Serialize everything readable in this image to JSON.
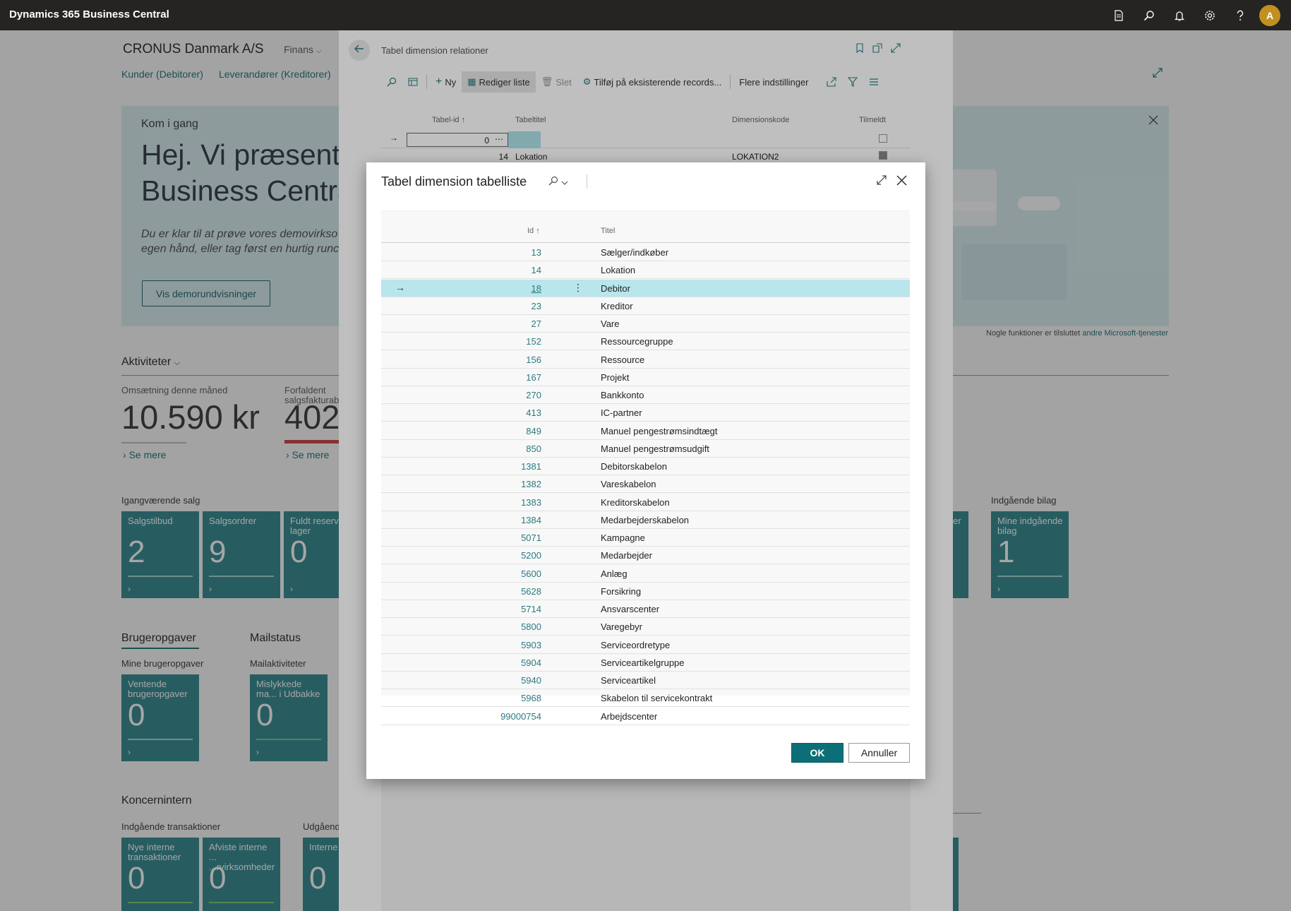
{
  "app": {
    "title": "Dynamics 365 Business Central",
    "avatar_initial": "A"
  },
  "topbar_icons": [
    "document-icon",
    "search-icon",
    "bell-icon",
    "gear-icon",
    "help-icon"
  ],
  "background": {
    "company": "CRONUS Danmark A/S",
    "role_menu": "Finans",
    "links": [
      "Kunder (Debitorer)",
      "Leverandører (Kreditorer)"
    ],
    "hero": {
      "kicker": "Kom i gang",
      "title_line1": "Hej. Vi præsent",
      "title_line2": "Business Centra",
      "sub_line1": "Du er klar til at prøve vores demovirkso",
      "sub_line2": "egen hånd, eller tag først en hurtig runc",
      "button": "Vis demorundvisninger",
      "note": "Nogle funktioner er tilsluttet",
      "note_link": "andre Microsoft-tjenester"
    },
    "activities": {
      "heading": "Aktiviteter",
      "kpi1_label": "Omsætning denne måned",
      "kpi1_value": "10.590 kr",
      "kpi2_label_line1": "Forfaldent",
      "kpi2_label_line2": "salgsfakturab",
      "kpi2_value": "402.",
      "see_more": "Se mere"
    },
    "ongoing_sales": {
      "label": "Igangværende salg",
      "tiles": [
        {
          "label": "Salgstilbud",
          "value": "2"
        },
        {
          "label": "Salgsordrer",
          "value": "9"
        },
        {
          "label": "Fuldt reserv fra lager",
          "value": "0"
        }
      ]
    },
    "incoming_docs": {
      "label": "Indgående bilag",
      "tile_label": "Mine indgående bilag",
      "tile_value": "1",
      "partial_tile_label": "er"
    },
    "user_tasks": {
      "heading": "Brugeropgaver",
      "label": "Mine brugeropgaver",
      "tile_label": "Ventende brugeropgaver",
      "tile_value": "0"
    },
    "mail": {
      "heading": "Mailstatus",
      "label": "Mailaktiviteter",
      "tile_label": "Mislykkede ma... i Udbakke",
      "tile_value": "0"
    },
    "intercompany": {
      "heading": "Koncernintern",
      "label_in": "Indgående transaktioner",
      "label_out": "Udgåend",
      "tiles": [
        {
          "label": "Nye interne transaktioner",
          "value": "0"
        },
        {
          "label": "Afviste interne ... ...rvirksomheder",
          "value": "0"
        },
        {
          "label": "Interne til afsen",
          "value": "0"
        }
      ]
    }
  },
  "panel": {
    "title": "Tabel dimension relationer",
    "commands": {
      "new": "Ny",
      "edit_list": "Rediger liste",
      "delete": "Slet",
      "add_existing": "Tilføj på eksisterende records...",
      "more": "Flere indstillinger"
    },
    "columns": {
      "table_id": "Tabel-id",
      "table_title": "Tabeltitel",
      "dim_code": "Dimensionskode",
      "enrolled": "Tilmeldt"
    },
    "rows": [
      {
        "id": "0",
        "title": "",
        "code": ""
      },
      {
        "id": "14",
        "title": "Lokation",
        "code": "LOKATION2"
      }
    ]
  },
  "modal": {
    "title": "Tabel dimension tabelliste",
    "col_id": "Id",
    "col_title": "Titel",
    "rows": [
      {
        "id": "13",
        "title": "Sælger/indkøber"
      },
      {
        "id": "14",
        "title": "Lokation"
      },
      {
        "id": "18",
        "title": "Debitor"
      },
      {
        "id": "23",
        "title": "Kreditor"
      },
      {
        "id": "27",
        "title": "Vare"
      },
      {
        "id": "152",
        "title": "Ressourcegruppe"
      },
      {
        "id": "156",
        "title": "Ressource"
      },
      {
        "id": "167",
        "title": "Projekt"
      },
      {
        "id": "270",
        "title": "Bankkonto"
      },
      {
        "id": "413",
        "title": "IC-partner"
      },
      {
        "id": "849",
        "title": "Manuel pengestrømsindtægt"
      },
      {
        "id": "850",
        "title": "Manuel pengestrømsudgift"
      },
      {
        "id": "1381",
        "title": "Debitorskabelon"
      },
      {
        "id": "1382",
        "title": "Vareskabelon"
      },
      {
        "id": "1383",
        "title": "Kreditorskabelon"
      },
      {
        "id": "1384",
        "title": "Medarbejderskabelon"
      },
      {
        "id": "5071",
        "title": "Kampagne"
      },
      {
        "id": "5200",
        "title": "Medarbejder"
      },
      {
        "id": "5600",
        "title": "Anlæg"
      },
      {
        "id": "5628",
        "title": "Forsikring"
      },
      {
        "id": "5714",
        "title": "Ansvarscenter"
      },
      {
        "id": "5800",
        "title": "Varegebyr"
      },
      {
        "id": "5903",
        "title": "Serviceordretype"
      },
      {
        "id": "5904",
        "title": "Serviceartikelgruppe"
      },
      {
        "id": "5940",
        "title": "Serviceartikel"
      },
      {
        "id": "5968",
        "title": "Skabelon til servicekontrakt"
      },
      {
        "id": "99000754",
        "title": "Arbejdscenter"
      }
    ],
    "selected_index": 2,
    "ok": "OK",
    "cancel": "Annuller"
  },
  "colors": {
    "accent": "#0c6f77",
    "tile": "#3c8f95",
    "selected_row": "#b8e6ec",
    "link": "#2a7b80"
  }
}
